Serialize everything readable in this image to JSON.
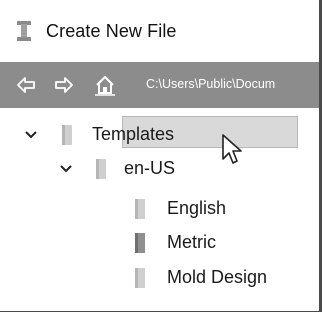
{
  "window": {
    "title": "Create New File"
  },
  "path_bar": {
    "path": "C:\\Users\\Public\\Docum"
  },
  "tree": {
    "items": [
      {
        "label": "Templates",
        "expanded": true
      },
      {
        "label": "en-US",
        "expanded": true
      },
      {
        "label": "English"
      },
      {
        "label": "Metric",
        "selected": true
      },
      {
        "label": "Mold Design"
      }
    ]
  },
  "icons": {
    "app": "template-icon",
    "back": "back-arrow-icon",
    "forward": "forward-arrow-icon",
    "home": "home-icon",
    "folder": "folder-icon",
    "chevron": "chevron-down-icon",
    "cursor": "mouse-pointer-icon"
  },
  "colors": {
    "path_bar_bg": "#8c8c8c",
    "selection_bg": "#d9d9d9",
    "folder": "#c8c8c8"
  }
}
